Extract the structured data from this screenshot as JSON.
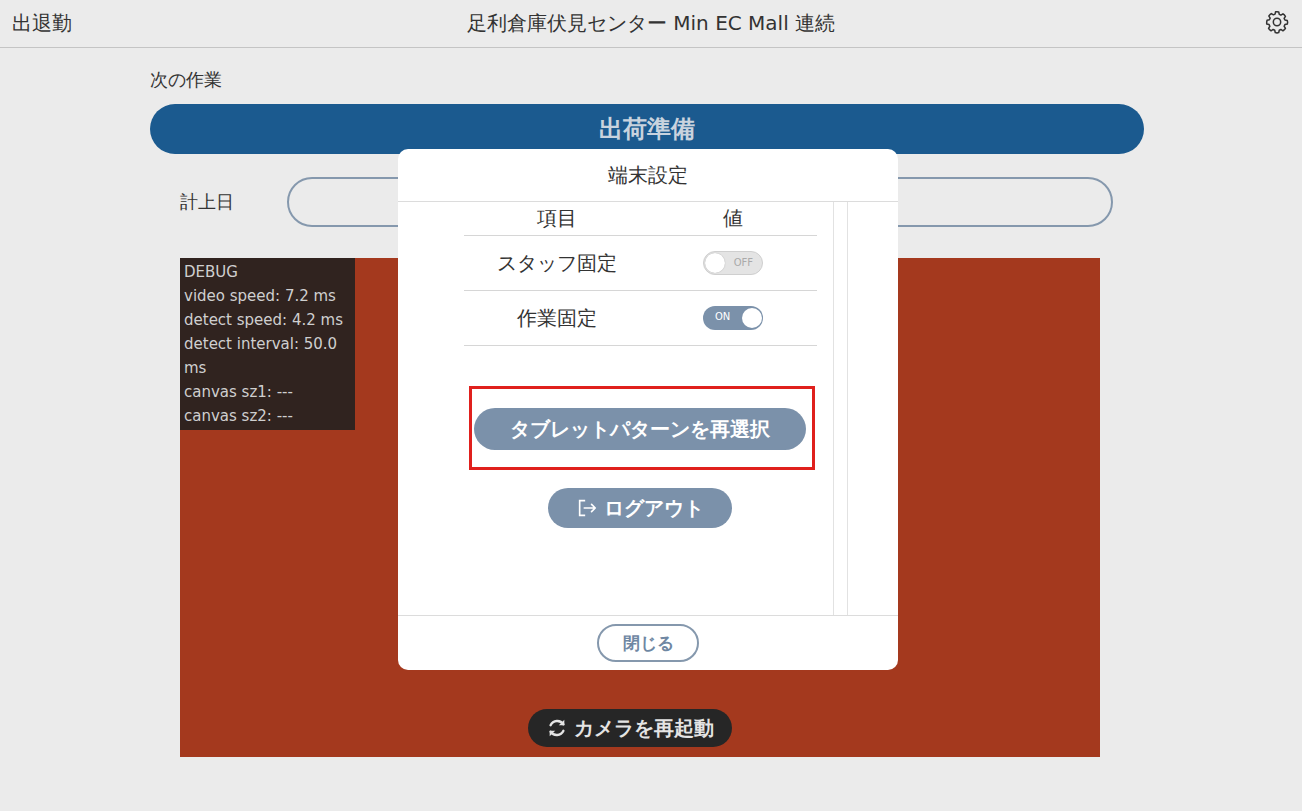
{
  "window": {
    "title": "足利倉庫伏見センター Min EC Mall 連続"
  },
  "top_bar": {
    "left_link": "出退勤"
  },
  "next_task": {
    "label": "次の作業",
    "button": "出荷準備"
  },
  "date": {
    "label": "計上日",
    "value": ""
  },
  "camera": {
    "debug": [
      "DEBUG",
      "video speed: 7.2 ms",
      "detect speed: 4.2 ms",
      "detect interval: 50.0 ms",
      "canvas sz1: ---",
      "canvas sz2: ---"
    ],
    "restart_button": "カメラを再起動"
  },
  "dialog": {
    "title": "端末設定",
    "columns": [
      "項目",
      "値"
    ],
    "rows": [
      {
        "label": "スタッフ固定",
        "on": false,
        "toggle_text": "OFF"
      },
      {
        "label": "作業固定",
        "on": true,
        "toggle_text": "ON"
      }
    ],
    "reselect_button": {
      "label": "タブレットパターンを再選択",
      "highlighted": true
    },
    "logout_button": "ログアウト",
    "close_button": "閉じる"
  }
}
